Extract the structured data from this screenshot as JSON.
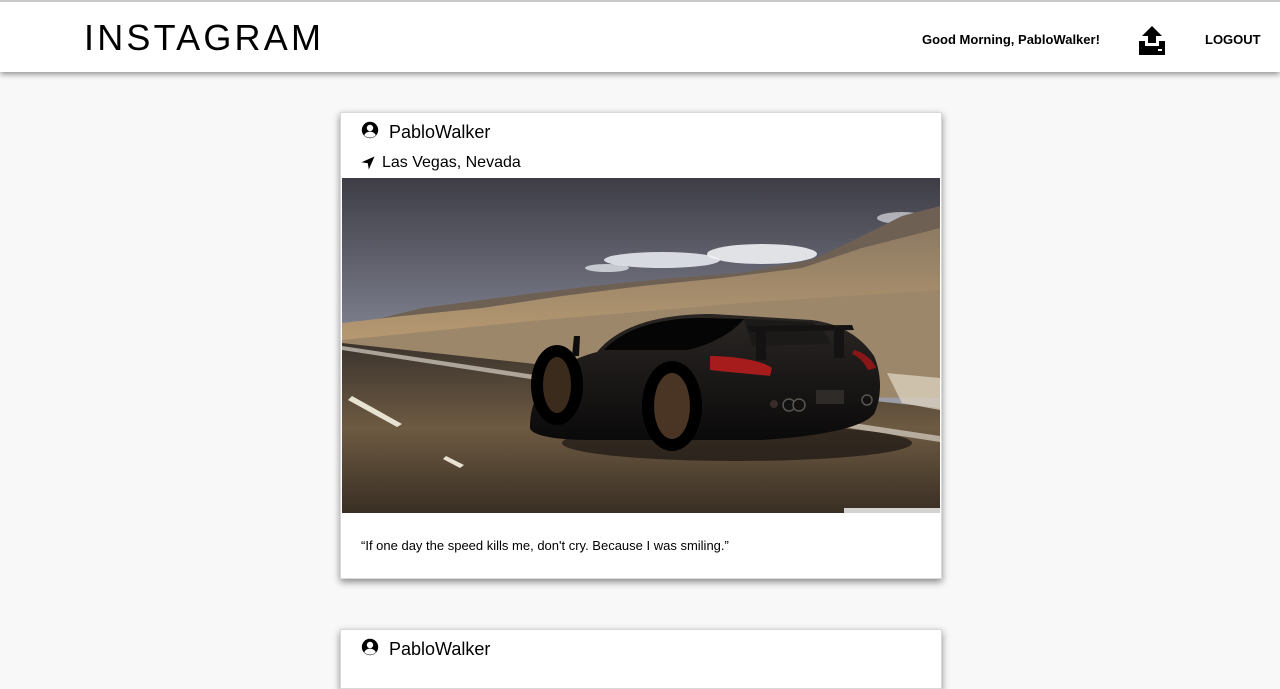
{
  "header": {
    "logo": "INSTAGRAM",
    "greeting": "Good Morning, PabloWalker!",
    "upload_icon": "upload-icon",
    "logout_label": "LOGOUT"
  },
  "posts": [
    {
      "username": "PabloWalker",
      "location": "Las Vegas, Nevada",
      "caption": "“If one day the speed kills me, don't cry. Because I was smiling.”",
      "user_icon": "user-circle-icon",
      "location_icon": "location-arrow-icon"
    },
    {
      "username": "PabloWalker",
      "user_icon": "user-circle-icon"
    }
  ]
}
